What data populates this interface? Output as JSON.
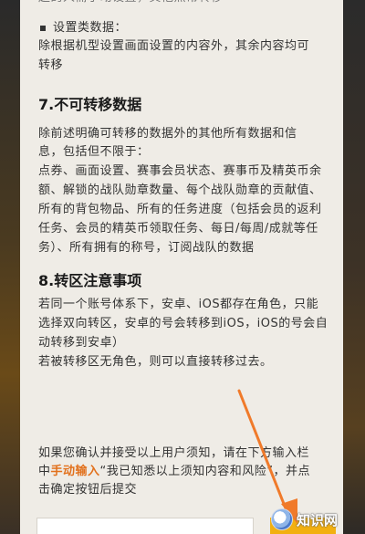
{
  "top_partial": "起的人需手动设置，其他照常转移",
  "settings_bullet": "设置类数据：",
  "settings_text": [
    "除根据机型设置画面设置的内容外，其余内容均可",
    "转移"
  ],
  "section7": {
    "title": "7.不可转移数据",
    "lines": [
      "除前述明确可转移的数据外的其他所有数据和信",
      "息，包括但不限于：",
      "点券、画面设置、赛事会员状态、赛事币及精英币余",
      "额、解锁的战队勋章数量、每个战队勋章的贡献值、",
      "所有的背包物品、所有的任务进度（包括会员的返利",
      "任务、会员的精英币领取任务、每日/每周/成就等任",
      "务）、所有拥有的称号，订阅战队的数据"
    ]
  },
  "section8": {
    "title": "8.转区注意事项",
    "lines": [
      "若同一个账号体系下，安卓、iOS都存在角色，只能",
      "选择双向转区，安卓的号会转移到iOS，iOS的号会自",
      "动转移到安卓）",
      "若被转移区无角色，则可以直接转移过去。"
    ]
  },
  "confirm_notice": {
    "line1": "如果您确认并接受以上用户须知，请在下方输入栏",
    "line2_before": "中",
    "line2_highlight": "手动输入",
    "line2_after": "“我已知悉以上须知内容和风险”，并点",
    "line3": "击确定按钮后提交"
  },
  "watermark_text": "知识网",
  "colors": {
    "panel_bg": "#efece6",
    "highlight": "#e2711d",
    "button": "#f2b010",
    "arrow": "#f07a2a"
  }
}
